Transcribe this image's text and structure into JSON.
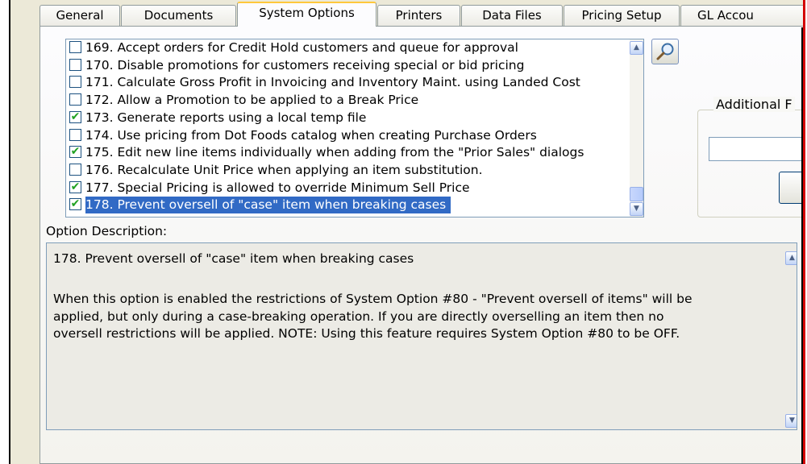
{
  "tabs": [
    {
      "label": "General"
    },
    {
      "label": "Documents"
    },
    {
      "label": "System Options"
    },
    {
      "label": "Printers"
    },
    {
      "label": "Data Files"
    },
    {
      "label": "Pricing Setup"
    },
    {
      "label": "GL Accou"
    }
  ],
  "active_tab": "System Options",
  "options": [
    {
      "text": "169. Accept orders for Credit Hold customers and queue for approval",
      "checked": false
    },
    {
      "text": "170. Disable promotions for customers receiving special or bid pricing",
      "checked": false
    },
    {
      "text": "171. Calculate Gross Profit in Invoicing and Inventory Maint. using Landed Cost",
      "checked": false
    },
    {
      "text": "172. Allow a Promotion to be applied to a Break Price",
      "checked": false
    },
    {
      "text": "173. Generate reports using a local temp file",
      "checked": true
    },
    {
      "text": "174. Use pricing from Dot Foods catalog when creating Purchase Orders",
      "checked": false
    },
    {
      "text": "175. Edit new line items individually when adding from the \"Prior Sales\" dialogs",
      "checked": true
    },
    {
      "text": "176. Recalculate Unit Price when applying an item substitution.",
      "checked": false
    },
    {
      "text": "177. Special Pricing is allowed to override Minimum Sell Price",
      "checked": true
    },
    {
      "text": "178. Prevent oversell of \"case\" item when breaking cases",
      "checked": true,
      "selected": true
    }
  ],
  "additional_group": {
    "legend": "Additional F"
  },
  "description": {
    "label": "Option Description:",
    "title": "178. Prevent oversell of \"case\" item when breaking cases",
    "body": "When this option is enabled the restrictions of System Option #80 - \"Prevent oversell of items\" will be\napplied, but only during a case-breaking operation. If you are directly overselling an item then no\noversell restrictions will be applied. NOTE: Using this feature requires System Option #80 to be OFF."
  },
  "icons": {
    "search": "magnifier-icon",
    "scroll_up": "scroll-up-arrow-icon",
    "scroll_down": "scroll-down-arrow-icon"
  },
  "colors": {
    "selection": "#316ac5",
    "checkmark": "#21a121",
    "active_tab_accent": "#ffc83c",
    "window_edge": "#d40000"
  }
}
